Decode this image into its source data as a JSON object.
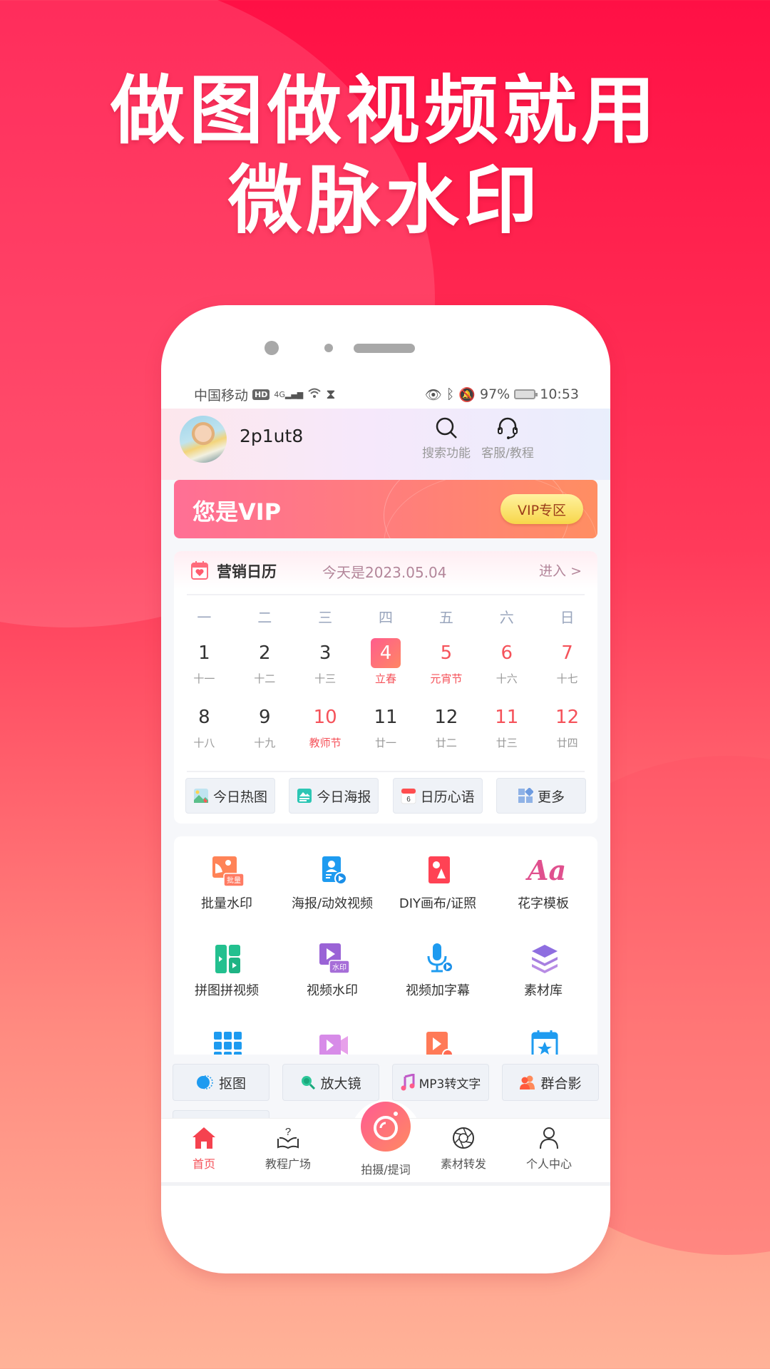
{
  "headline": {
    "line1": "做图做视频就用",
    "line2": "微脉水印"
  },
  "status_bar": {
    "carrier": "中国移动",
    "hd_badge": "HD",
    "network": "4G",
    "battery": "97%",
    "time": "10:53"
  },
  "header": {
    "username": "2p1ut8",
    "search_label": "搜索功能",
    "service_label": "客服/教程"
  },
  "vip_banner": {
    "title": "您是VIP",
    "button_label": "VIP专区"
  },
  "calendar": {
    "title": "营销日历",
    "today_text": "今天是2023.05.04",
    "enter_label": "进入 >",
    "weekdays": [
      "一",
      "二",
      "三",
      "四",
      "五",
      "六",
      "日"
    ],
    "weeks": [
      [
        {
          "day": "1",
          "sub": "十一"
        },
        {
          "day": "2",
          "sub": "十二"
        },
        {
          "day": "3",
          "sub": "十三"
        },
        {
          "day": "4",
          "sub": "立春",
          "today": true,
          "festival": true
        },
        {
          "day": "5",
          "sub": "元宵节",
          "red": true,
          "festival": true
        },
        {
          "day": "6",
          "sub": "十六",
          "red": true
        },
        {
          "day": "7",
          "sub": "十七",
          "red": true
        }
      ],
      [
        {
          "day": "8",
          "sub": "十八"
        },
        {
          "day": "9",
          "sub": "十九"
        },
        {
          "day": "10",
          "sub": "教师节",
          "red": true,
          "festival": true
        },
        {
          "day": "11",
          "sub": "廿一"
        },
        {
          "day": "12",
          "sub": "廿二"
        },
        {
          "day": "11",
          "sub": "廿三",
          "red": true
        },
        {
          "day": "12",
          "sub": "廿四",
          "red": true
        }
      ]
    ],
    "quick_buttons": [
      {
        "label": "今日热图",
        "icon": "hot-image-icon"
      },
      {
        "label": "今日海报",
        "icon": "poster-icon"
      },
      {
        "label": "日历心语",
        "icon": "calendar-day-icon",
        "icon_text": "6"
      },
      {
        "label": "更多",
        "icon": "more-grid-icon"
      }
    ]
  },
  "features": [
    {
      "label": "批量水印",
      "icon": "batch-watermark-icon",
      "badge": "批量"
    },
    {
      "label": "海报/动效视频",
      "icon": "poster-video-icon"
    },
    {
      "label": "DIY画布/证照",
      "icon": "diy-canvas-icon"
    },
    {
      "label": "花字模板",
      "icon": "fancy-text-icon",
      "glyph": "Aa"
    },
    {
      "label": "拼图拼视频",
      "icon": "collage-icon"
    },
    {
      "label": "视频水印",
      "icon": "video-watermark-icon",
      "badge": "水印"
    },
    {
      "label": "视频加字幕",
      "icon": "subtitle-mic-icon"
    },
    {
      "label": "素材库",
      "icon": "layers-icon"
    },
    {
      "label": "",
      "icon": "apps-grid-icon"
    },
    {
      "label": "",
      "icon": "video-camera-icon"
    },
    {
      "label": "",
      "icon": "video-add-icon"
    },
    {
      "label": "",
      "icon": "calendar-star-icon"
    }
  ],
  "tools": [
    {
      "label": "抠图",
      "icon": "cutout-icon"
    },
    {
      "label": "放大镜",
      "icon": "magnifier-icon"
    },
    {
      "label": "MP3转文字",
      "icon": "music-note-icon"
    },
    {
      "label": "群合影",
      "icon": "group-photo-icon"
    }
  ],
  "bottom_nav": [
    {
      "label": "首页",
      "icon": "home-icon",
      "active": true
    },
    {
      "label": "教程广场",
      "icon": "tutorial-book-icon"
    },
    {
      "label": "拍摄/提词",
      "icon": "camera-icon"
    },
    {
      "label": "素材转发",
      "icon": "aperture-icon"
    },
    {
      "label": "个人中心",
      "icon": "user-icon"
    }
  ],
  "colors": {
    "accent_red": "#f5525a",
    "vip_gradient_start": "#ff6f95",
    "vip_gradient_end": "#ff8e62",
    "vip_button": "#f7d64a"
  }
}
